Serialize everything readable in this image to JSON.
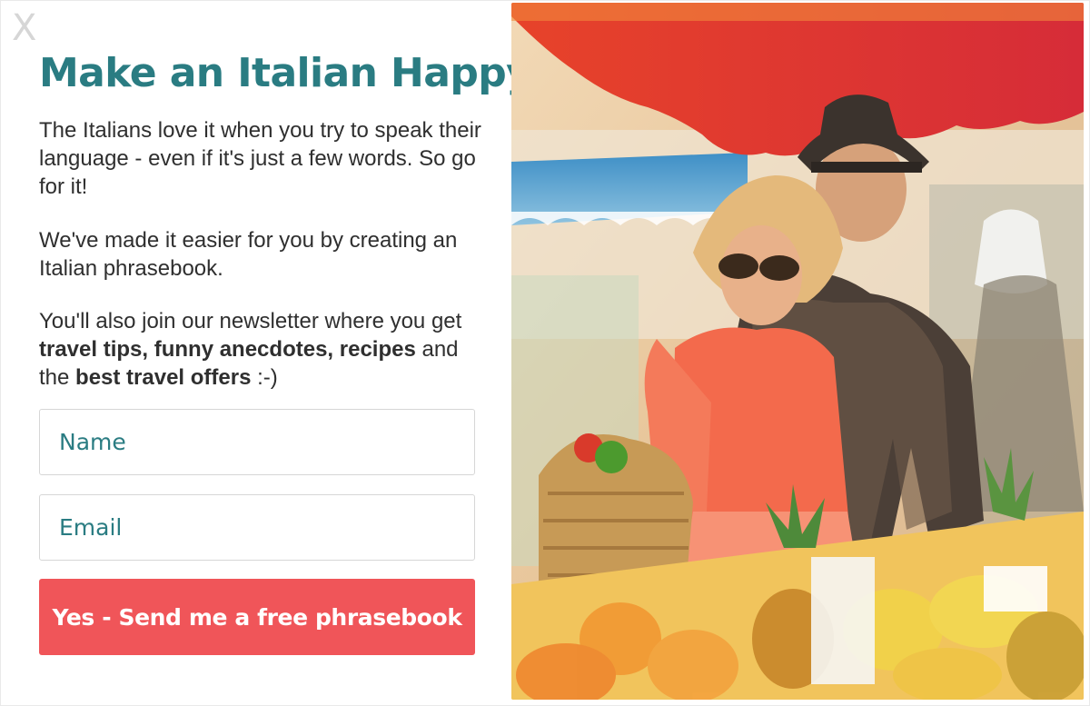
{
  "popup": {
    "close_label": "X",
    "title": "Make an Italian Happy",
    "paragraph1": "The Italians love it when you try to speak their language - even if it's just a few words. So go for it!",
    "paragraph2": "We've made it easier for you by creating an Italian phrasebook.",
    "paragraph3": {
      "text1": "You'll also join our newsletter where you get ",
      "bold1": "travel tips, funny anecdotes, recipes",
      "text2": " and the ",
      "bold2": "best travel offers",
      "text3": " :-)"
    },
    "form": {
      "name_placeholder": "Name",
      "email_placeholder": "Email",
      "submit_label": "Yes - Send me a free phrasebook"
    }
  },
  "colors": {
    "title": "#2a7c82",
    "button": "#f05559",
    "text": "#2f2f2f",
    "border": "#d6d6d6"
  },
  "icons": {
    "close": "close-icon"
  }
}
